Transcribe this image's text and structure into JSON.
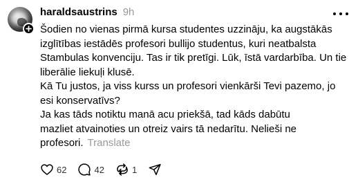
{
  "post": {
    "username": "haraldsaustrins",
    "time": "9h",
    "lines": [
      "Šodien no vienas pirmā kursa studentes uzzināju, ka augstākās",
      "izglītības iestādēs profesori bullijo studentus, kuri neatbalsta",
      "Stambulas konvenciju. Tas ir tik pretīgi. Lūk, īstā vardarbība. Un tie",
      "liberālie liekuļi klusē.",
      "Kā Tu justos, ja viss kurss un profesori vienkārši Tevi pazemo, jo",
      "esi konservatīvs?",
      "Ja kas tāds notiktu manā acu priekšā, tad kāds dabūtu",
      "mazliet atvainoties un otreiz vairs tā nedarītu. Nelieši ne",
      "profesori."
    ],
    "translate_label": "Translate"
  },
  "actions": {
    "likes": "62",
    "replies": "42",
    "reposts": "1"
  },
  "icons": {
    "follow": "plus-icon",
    "more": "more-icon",
    "like": "heart-icon",
    "reply": "comment-icon",
    "repost": "repost-icon",
    "share": "send-icon"
  }
}
